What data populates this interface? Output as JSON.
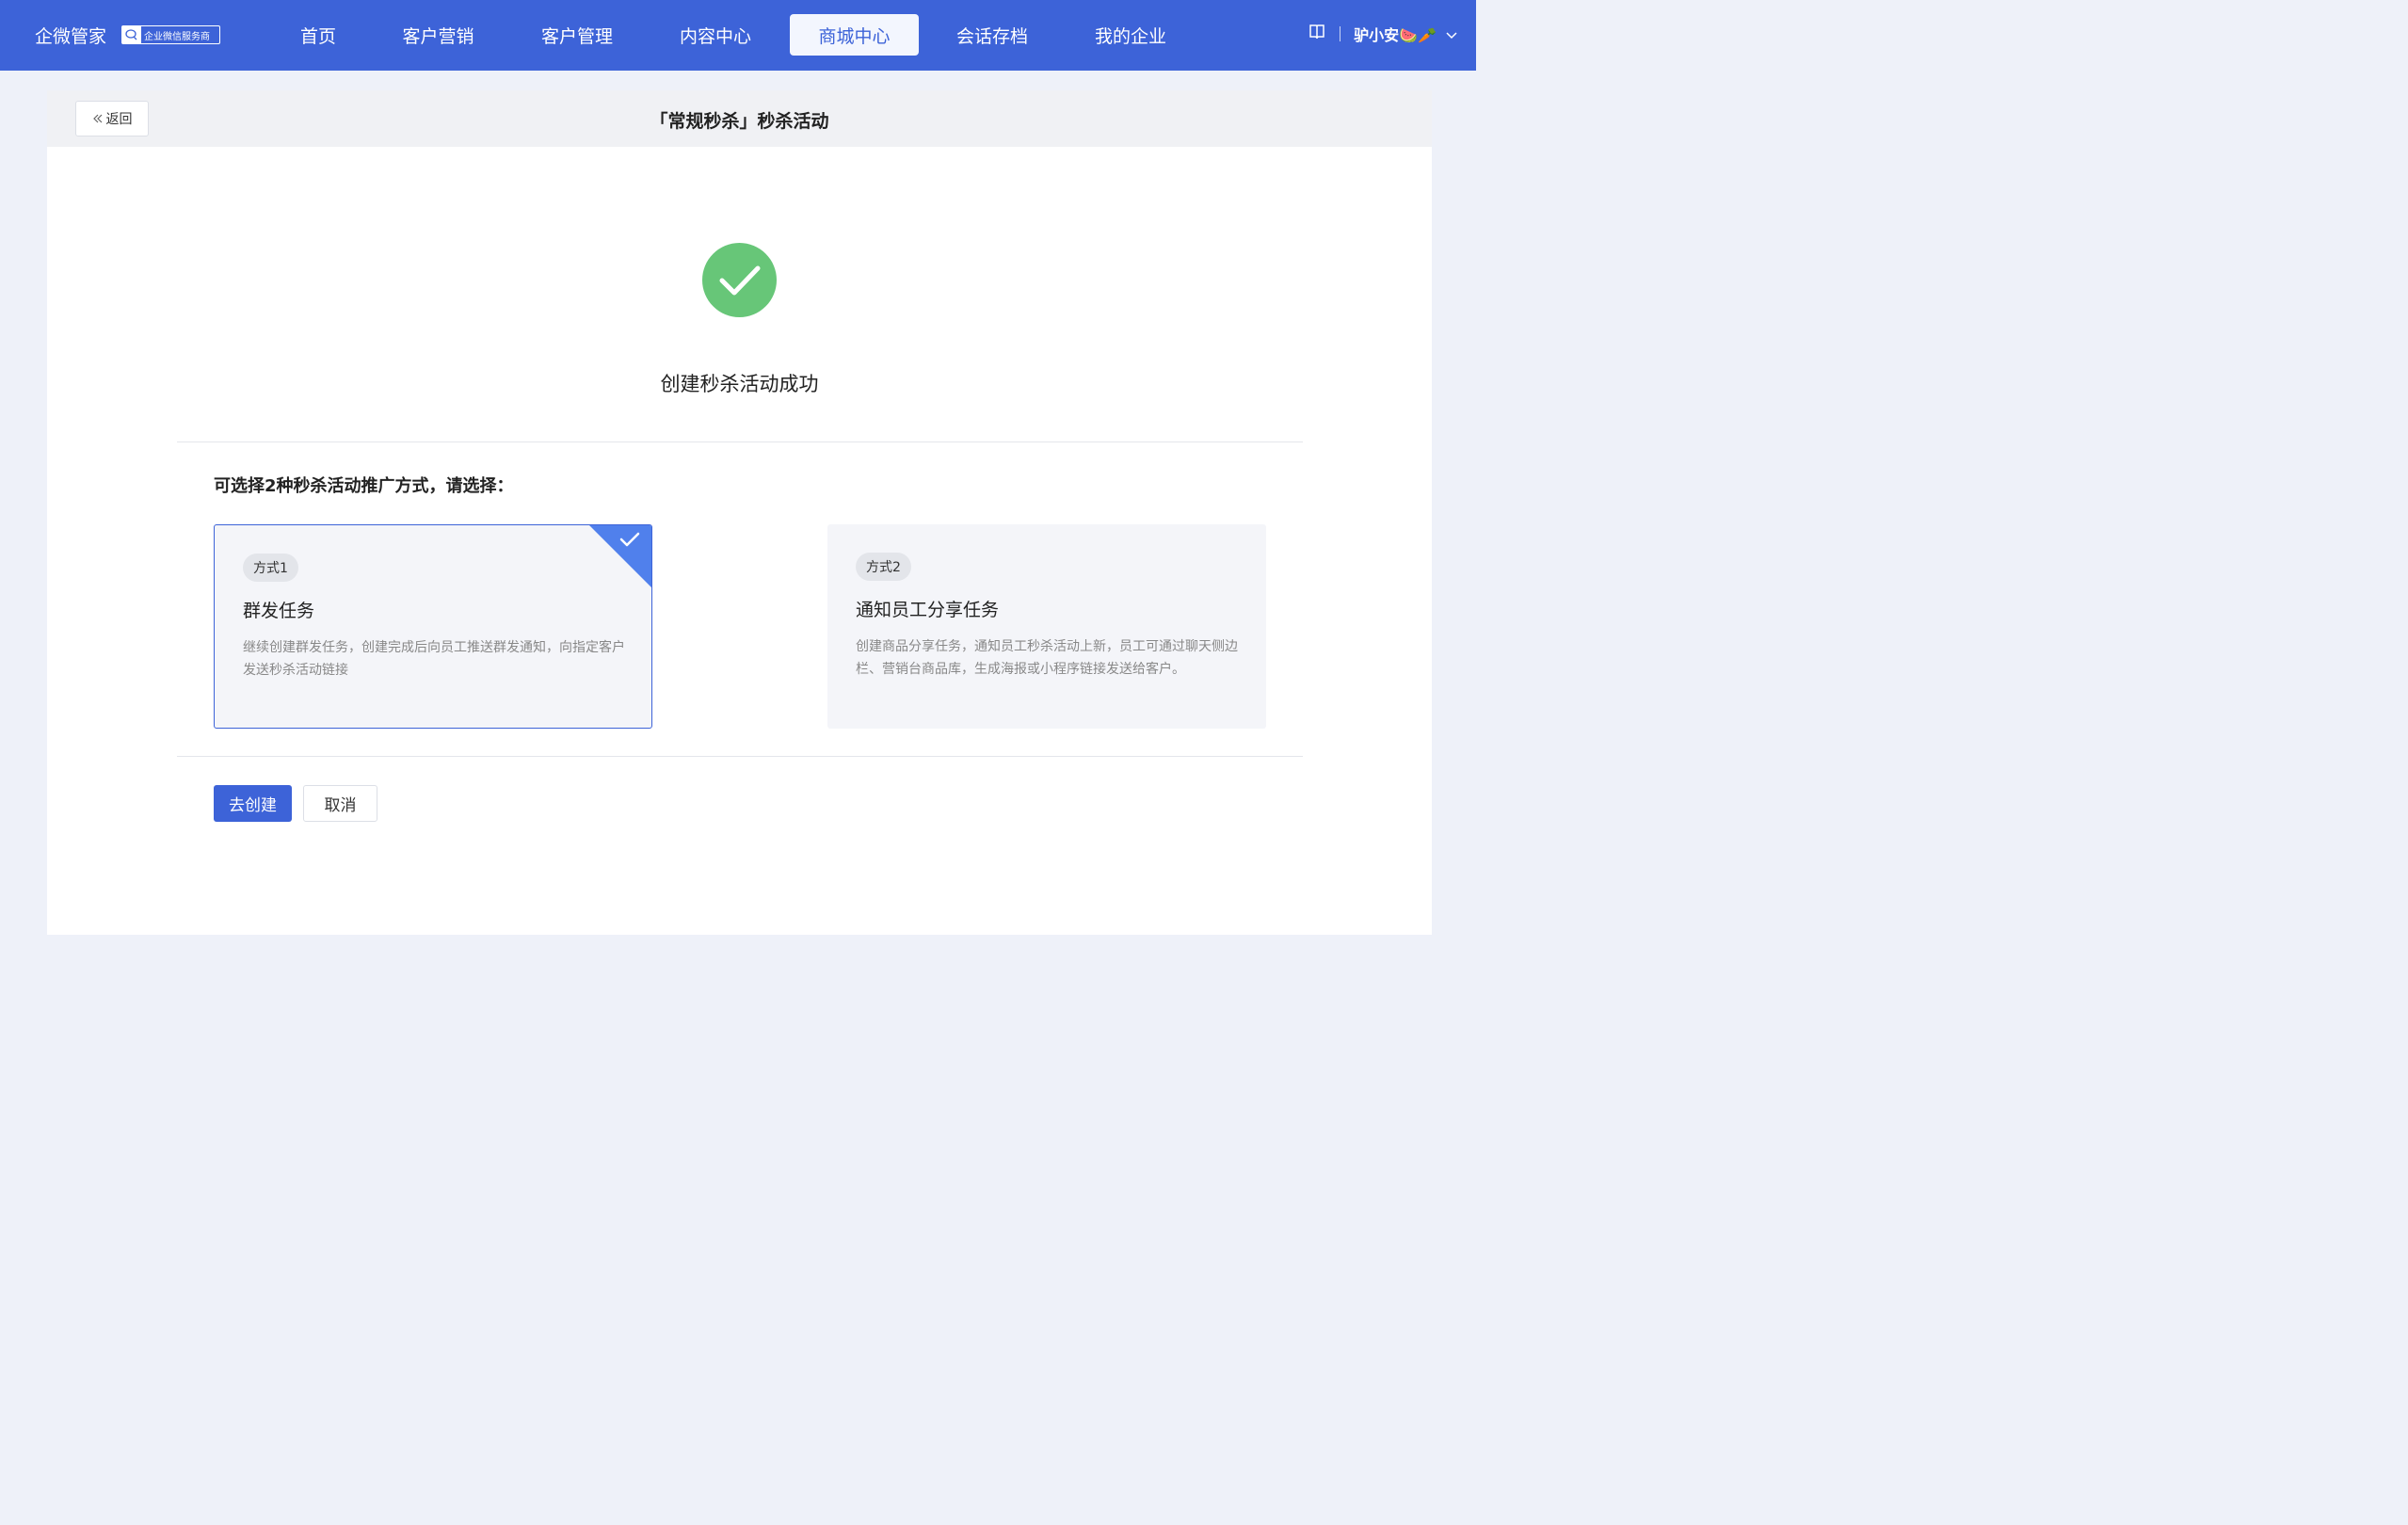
{
  "header": {
    "brand": "企微管家",
    "brand_tag": "企业微信服务商",
    "nav": [
      {
        "label": "首页",
        "active": false
      },
      {
        "label": "客户营销",
        "active": false
      },
      {
        "label": "客户管理",
        "active": false
      },
      {
        "label": "内容中心",
        "active": false
      },
      {
        "label": "商城中心",
        "active": true
      },
      {
        "label": "会话存档",
        "active": false
      },
      {
        "label": "我的企业",
        "active": false
      }
    ],
    "user_name": "驴小安🍉🥕",
    "accent_color": "#3d63d8"
  },
  "page": {
    "back_label": "返回",
    "title": "「常规秒杀」秒杀活动",
    "success_message": "创建秒杀活动成功",
    "choose_prompt": "可选择2种秒杀活动推广方式，请选择：",
    "options": [
      {
        "badge": "方式1",
        "title": "群发任务",
        "description": "继续创建群发任务，创建完成后向员工推送群发通知，向指定客户发送秒杀活动链接",
        "selected": true
      },
      {
        "badge": "方式2",
        "title": "通知员工分享任务",
        "description": "创建商品分享任务，通知员工秒杀活动上新，员工可通过聊天侧边栏、营销台商品库，生成海报或小程序链接发送给客户。",
        "selected": false
      }
    ],
    "primary_button": "去创建",
    "cancel_button": "取消",
    "success_color": "#67c678"
  }
}
